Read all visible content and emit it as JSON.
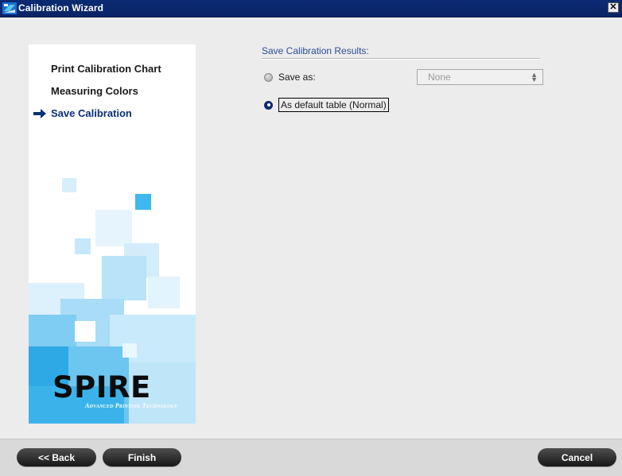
{
  "window": {
    "title": "Calibration Wizard",
    "close_glyph": "✕"
  },
  "sidebar": {
    "steps": [
      {
        "label": "Print Calibration Chart",
        "current": false
      },
      {
        "label": "Measuring Colors",
        "current": false
      },
      {
        "label": "Save Calibration",
        "current": true
      }
    ],
    "current_step_icon": "arrow-right-icon",
    "logo": {
      "brand": "SPIRE",
      "tagline": "Advanced Printing Technology"
    }
  },
  "main": {
    "section_title": "Save Calibration Results:",
    "options": [
      {
        "label": "Save as:",
        "selected": false
      },
      {
        "label": "As default table (Normal)",
        "selected": true
      }
    ],
    "save_as_select": {
      "value": "None",
      "enabled": false
    }
  },
  "footer": {
    "back_label": "<< Back",
    "finish_label": "Finish",
    "cancel_label": "Cancel"
  },
  "colors": {
    "titlebar": "#0b2a72",
    "accent_text": "#2a4d96",
    "button": "#1f1f1f",
    "deco_blue": "#37b6ee"
  }
}
